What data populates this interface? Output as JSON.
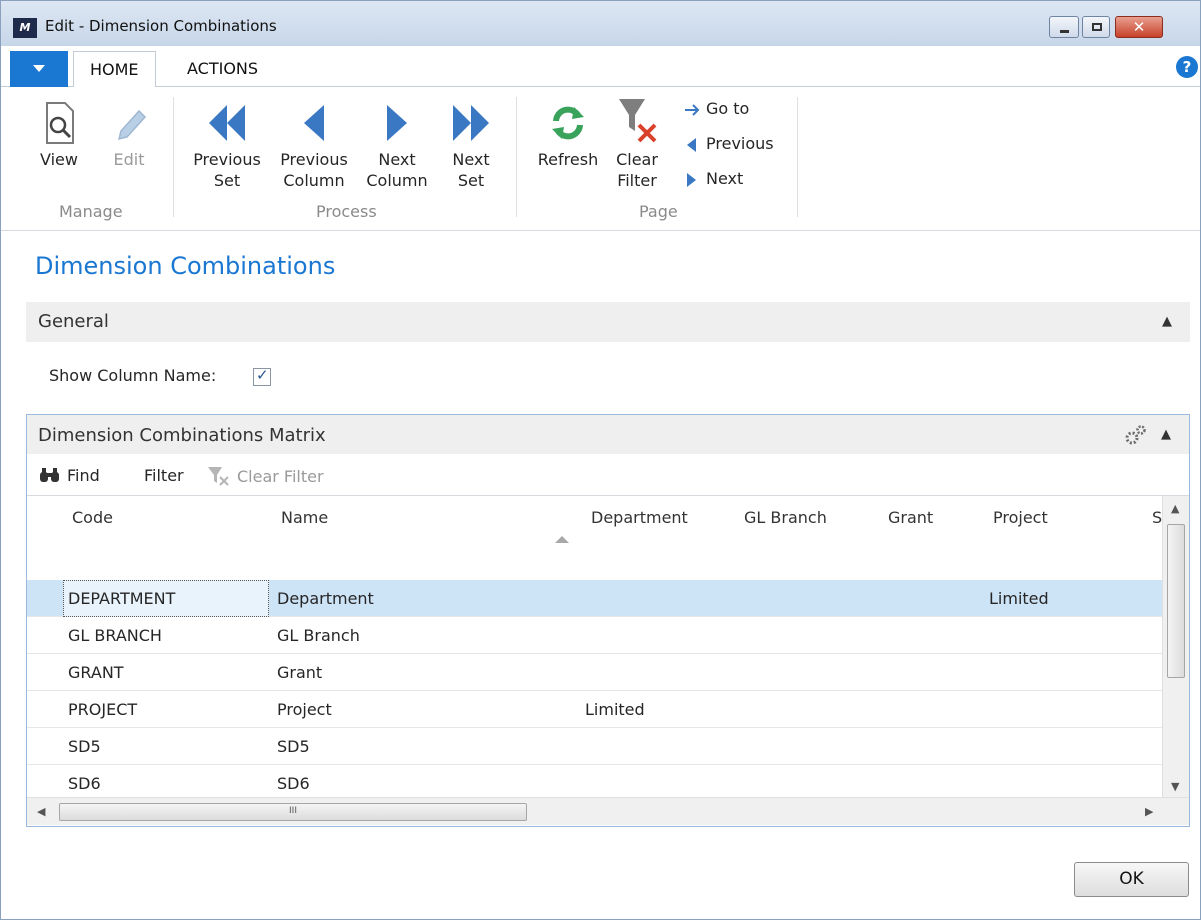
{
  "window": {
    "title": "Edit - Dimension Combinations",
    "logo_text": "M",
    "close_glyph": "✕"
  },
  "ribbon": {
    "tabs": [
      "HOME",
      "ACTIONS"
    ],
    "manage": {
      "group_label": "Manage",
      "view": "View",
      "edit": "Edit"
    },
    "process": {
      "group_label": "Process",
      "previous_set": [
        "Previous",
        "Set"
      ],
      "previous_column": [
        "Previous",
        "Column"
      ],
      "next_column": [
        "Next",
        "Column"
      ],
      "next_set": [
        "Next",
        "Set"
      ]
    },
    "page": {
      "group_label": "Page",
      "refresh": "Refresh",
      "clear_filter": [
        "Clear",
        "Filter"
      ],
      "go_to": "Go to",
      "previous": "Previous",
      "next": "Next"
    }
  },
  "page_title": "Dimension Combinations",
  "general": {
    "title": "General",
    "show_column_name_label": "Show Column Name:",
    "show_column_name_checked": true
  },
  "matrix": {
    "title": "Dimension Combinations Matrix",
    "toolbar": {
      "find": "Find",
      "filter": "Filter",
      "clear_filter": "Clear Filter"
    },
    "columns": [
      "Code",
      "Name",
      "Department",
      "GL Branch",
      "Grant",
      "Project",
      "S"
    ],
    "rows": [
      {
        "code": "DEPARTMENT",
        "name": "Department",
        "department": "",
        "gl_branch": "",
        "grant": "",
        "project": "Limited"
      },
      {
        "code": "GL BRANCH",
        "name": "GL Branch",
        "department": "",
        "gl_branch": "",
        "grant": "",
        "project": ""
      },
      {
        "code": "GRANT",
        "name": "Grant",
        "department": "",
        "gl_branch": "",
        "grant": "",
        "project": ""
      },
      {
        "code": "PROJECT",
        "name": "Project",
        "department": "Limited",
        "gl_branch": "",
        "grant": "",
        "project": ""
      },
      {
        "code": "SD5",
        "name": "SD5",
        "department": "",
        "gl_branch": "",
        "grant": "",
        "project": ""
      },
      {
        "code": "SD6",
        "name": "SD6",
        "department": "",
        "gl_branch": "",
        "grant": "",
        "project": ""
      }
    ],
    "selected_row": 0,
    "hscroll_thumb_text": "III"
  },
  "ok_button": "OK",
  "colors": {
    "accent": "#1a77d2",
    "selection": "#cde3f6",
    "ribbon_arrow": "#3a78c4",
    "refresh": "#3aa35b",
    "clear_x": "#d9412b"
  }
}
